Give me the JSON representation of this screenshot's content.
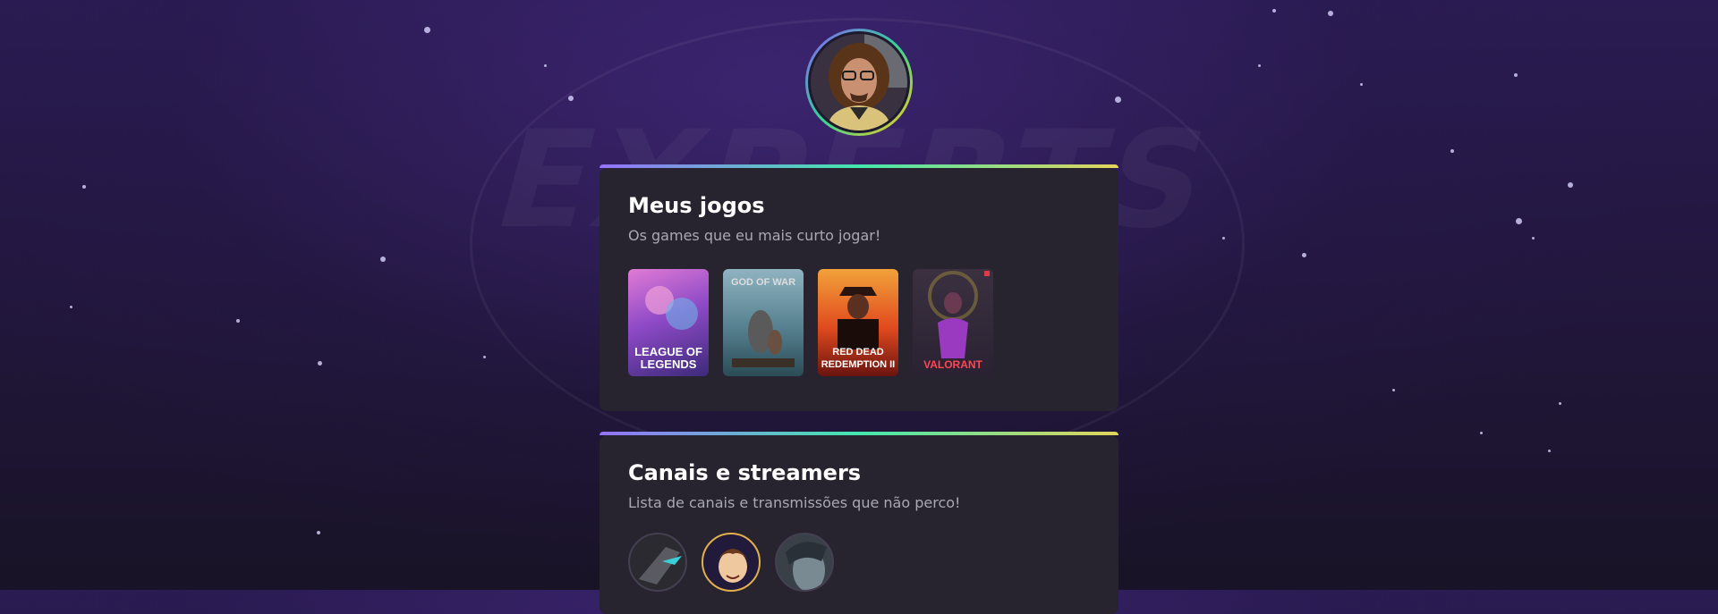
{
  "profile": {
    "avatar_icon": "profile-photo"
  },
  "games_section": {
    "title": "Meus jogos",
    "subtitle": "Os games que eu mais curto jogar!",
    "games": [
      {
        "name": "LEAGUE OF LEGENDS",
        "color": "#7a3ab0"
      },
      {
        "name": "GOD OF WAR",
        "color": "#5f8ea0"
      },
      {
        "name": "RED DEAD REDEMPTION II",
        "color": "#c8281e"
      },
      {
        "name": "VALORANT",
        "color": "#3a2a4a"
      }
    ]
  },
  "channels_section": {
    "title": "Canais e streamers",
    "subtitle": "Lista de canais e transmissões que não perco!",
    "streamers": [
      {
        "icon": "streamer-avatar-1"
      },
      {
        "icon": "streamer-avatar-2"
      },
      {
        "icon": "streamer-avatar-3"
      }
    ]
  },
  "colors": {
    "accent_purple": "#9572fc",
    "accent_green": "#43e7ad",
    "accent_yellow": "#e2d45c",
    "card_bg": "#27232f"
  }
}
